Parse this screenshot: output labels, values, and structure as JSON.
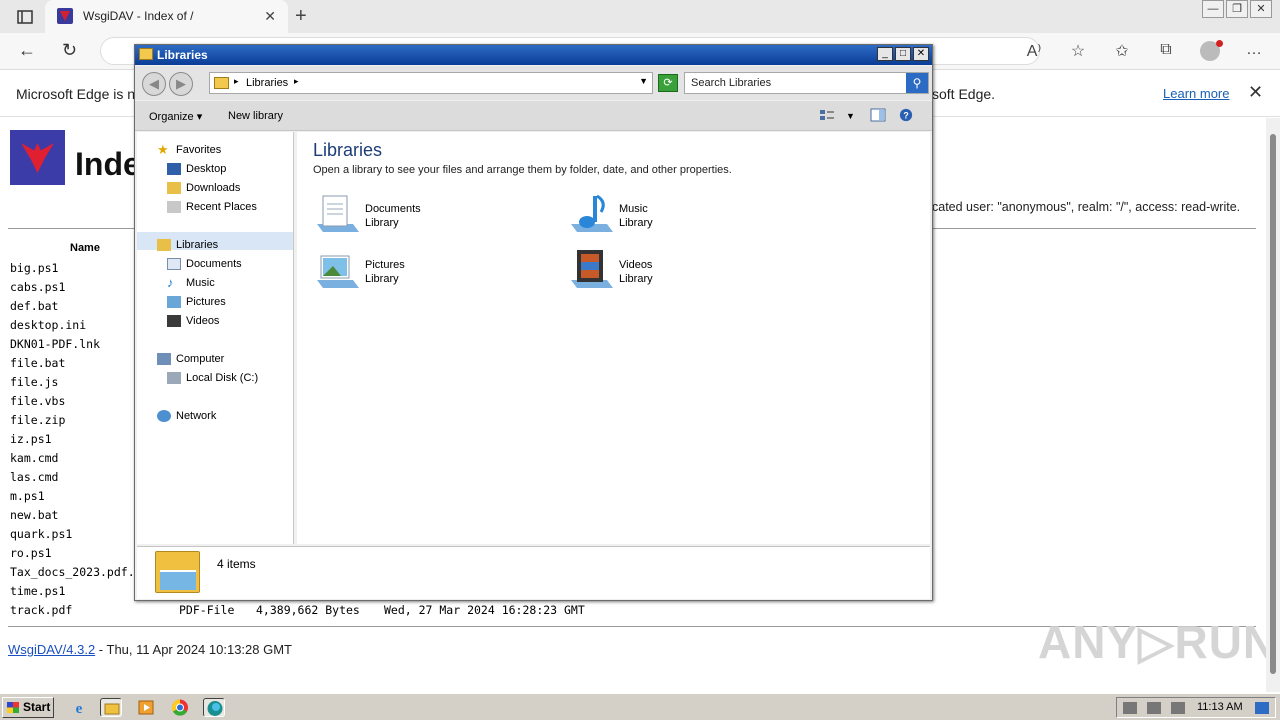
{
  "browser": {
    "tab_title": "WsgiDAV - Index of /",
    "tab_close": "✕",
    "new_tab": "+",
    "win_min": "—",
    "win_restore": "❐",
    "win_close": "✕",
    "back": "←",
    "reload": "↻",
    "toolbar_icons": [
      "A⁾",
      "☆",
      "✩",
      "⧉",
      "…"
    ]
  },
  "infobar": {
    "message_start": "Microsoft Edge is no",
    "message_end": "soft Edge.",
    "learn_more": "Learn more",
    "close": "✕"
  },
  "page": {
    "heading": "Inde",
    "auth_info": "cated user: \"anonymous\", realm: \"/\", access: read-write.",
    "name_header": "Name",
    "files": [
      {
        "name": "big.ps1",
        "type": "",
        "size": "",
        "date": ""
      },
      {
        "name": "cabs.ps1",
        "type": "",
        "size": "",
        "date": ""
      },
      {
        "name": "def.bat",
        "type": "",
        "size": "",
        "date": ""
      },
      {
        "name": "desktop.ini",
        "type": "",
        "size": "",
        "date": ""
      },
      {
        "name": "DKN01-PDF.lnk",
        "type": "",
        "size": "",
        "date": ""
      },
      {
        "name": "file.bat",
        "type": "",
        "size": "",
        "date": ""
      },
      {
        "name": "file.js",
        "type": "",
        "size": "",
        "date": ""
      },
      {
        "name": "file.vbs",
        "type": "",
        "size": "",
        "date": ""
      },
      {
        "name": "file.zip",
        "type": "",
        "size": "",
        "date": ""
      },
      {
        "name": "iz.ps1",
        "type": "",
        "size": "",
        "date": ""
      },
      {
        "name": "kam.cmd",
        "type": "",
        "size": "",
        "date": ""
      },
      {
        "name": "las.cmd",
        "type": "",
        "size": "",
        "date": ""
      },
      {
        "name": "m.ps1",
        "type": "",
        "size": "",
        "date": ""
      },
      {
        "name": "new.bat",
        "type": "",
        "size": "",
        "date": ""
      },
      {
        "name": "quark.ps1",
        "type": "",
        "size": "",
        "date": ""
      },
      {
        "name": "ro.ps1",
        "type": "",
        "size": "",
        "date": ""
      },
      {
        "name": "Tax_docs_2023.pdf.",
        "type": "",
        "size": "",
        "date": ""
      },
      {
        "name": "time.ps1",
        "type": "",
        "size": "",
        "date": ""
      },
      {
        "name": "track.pdf",
        "type": "PDF-File",
        "size": "4,389,662 Bytes",
        "date": "Wed, 27 Mar 2024 16:28:23 GMT"
      }
    ],
    "footer_link": "WsgiDAV/4.3.2",
    "footer_text": " - Thu, 11 Apr 2024 10:13:28 GMT",
    "watermark": "ANY▷RUN"
  },
  "explorer": {
    "title": "Libraries",
    "title_min": "_",
    "title_max": "□",
    "title_close": "✕",
    "back": "◀",
    "forward": "▶",
    "address": "Libraries",
    "search_placeholder": "Search Libraries",
    "search_btn": "⚲",
    "refresh": "⟳",
    "organize": "Organize",
    "new_library": "New library",
    "nav": {
      "favorites": "Favorites",
      "desktop": "Desktop",
      "downloads": "Downloads",
      "recent": "Recent Places",
      "libraries": "Libraries",
      "documents": "Documents",
      "music": "Music",
      "pictures": "Pictures",
      "videos": "Videos",
      "computer": "Computer",
      "local_disk": "Local Disk (C:)",
      "network": "Network"
    },
    "main_title": "Libraries",
    "main_sub": "Open a library to see your files and arrange them by folder, date, and other properties.",
    "libraries": [
      {
        "name": "Documents",
        "kind": "Library"
      },
      {
        "name": "Music",
        "kind": "Library"
      },
      {
        "name": "Pictures",
        "kind": "Library"
      },
      {
        "name": "Videos",
        "kind": "Library"
      }
    ],
    "status_count": "4 items"
  },
  "taskbar": {
    "start": "Start",
    "clock": "11:13 AM"
  }
}
